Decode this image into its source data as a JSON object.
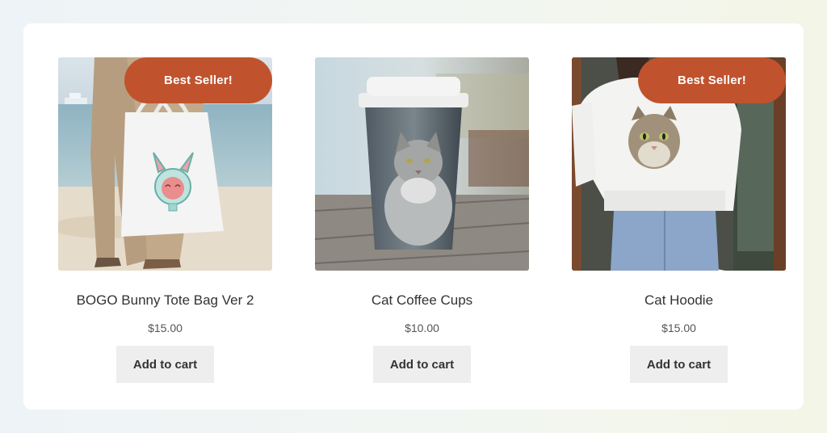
{
  "products": [
    {
      "title": "BOGO Bunny Tote Bag Ver 2",
      "price": "$15.00",
      "badge": "Best Seller!",
      "button_label": "Add to cart"
    },
    {
      "title": "Cat Coffee Cups",
      "price": "$10.00",
      "button_label": "Add to cart"
    },
    {
      "title": "Cat Hoodie",
      "price": "$15.00",
      "badge": "Best Seller!",
      "button_label": "Add to cart"
    }
  ],
  "colors": {
    "badge": "#c0532d",
    "button_bg": "#eeeeee",
    "panel_bg": "#ffffff"
  }
}
